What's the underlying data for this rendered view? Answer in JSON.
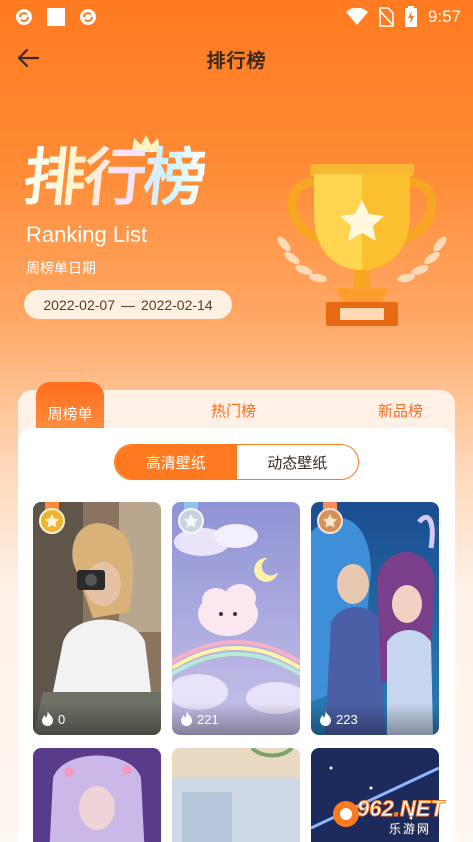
{
  "status_bar": {
    "time": "9:57",
    "left_icons": [
      "sync-icon",
      "square-icon",
      "sync-icon"
    ],
    "right_icons": [
      "wifi-icon",
      "no-sim-icon",
      "battery-charging-icon"
    ]
  },
  "app_bar": {
    "back_icon": "back-arrow-icon",
    "title": "排行榜"
  },
  "hero": {
    "title": "排行榜",
    "subtitle": "Ranking List",
    "period_label": "周榜单日期",
    "date_start": "2022-02-07",
    "date_separator": "—",
    "date_end": "2022-02-14"
  },
  "tabs": [
    {
      "label": "周榜单",
      "active": true
    },
    {
      "label": "热门榜",
      "active": false
    },
    {
      "label": "新品榜",
      "active": false
    }
  ],
  "segments": [
    {
      "label": "高清壁纸",
      "active": true
    },
    {
      "label": "动态壁纸",
      "active": false
    }
  ],
  "cards": [
    {
      "rank": 1,
      "medal": "gold",
      "count": "0",
      "scene": "girl-with-camera"
    },
    {
      "rank": 2,
      "medal": "silver",
      "count": "221",
      "scene": "cloud-moon-rainbow"
    },
    {
      "rank": 3,
      "medal": "bronze",
      "count": "223",
      "scene": "anime-couple"
    },
    {
      "rank": 4,
      "medal": "",
      "count": "",
      "scene": "anime-fairy"
    },
    {
      "rank": 5,
      "medal": "",
      "count": "",
      "scene": "illustration"
    },
    {
      "rank": 6,
      "medal": "",
      "count": "",
      "scene": "starry-sky"
    }
  ],
  "watermark": {
    "number_a": "962",
    "dot": ".",
    "number_b": "NET",
    "subtitle": "乐游网"
  },
  "colors": {
    "accent": "#ff7a1f",
    "gold": "#f2b233",
    "silver": "#c9d3dd",
    "bronze": "#d4925a"
  }
}
